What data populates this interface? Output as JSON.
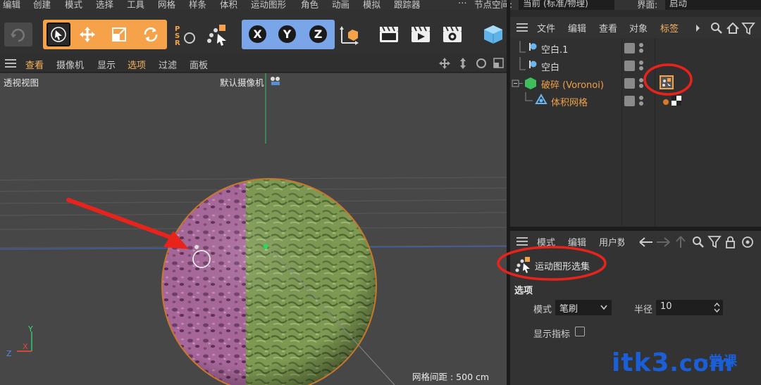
{
  "menubar": {
    "items": [
      "编辑",
      "创建",
      "模式",
      "选择",
      "工具",
      "网格",
      "样条",
      "体积",
      "运动图形",
      "角色",
      "动画",
      "模拟",
      "跟踪器"
    ],
    "node_space_label": "节点空间:",
    "node_space_value": "当前 (标准/物理)",
    "layout_label": "界面:",
    "layout_value": "启动"
  },
  "toolbar": {
    "axis_x": "X",
    "axis_y": "Y",
    "axis_z": "Z"
  },
  "viewport": {
    "menu": [
      "查看",
      "摄像机",
      "显示",
      "选项",
      "过滤",
      "面板"
    ],
    "title": "透视视图",
    "camera": "默认摄像机",
    "grid_spacing": "网格间距 : 500 cm",
    "axis_labels": {
      "y": "Y",
      "x": "X",
      "z": "Z"
    }
  },
  "object_manager": {
    "menu": [
      "文件",
      "编辑",
      "查看",
      "对象",
      "标签"
    ],
    "objects": [
      {
        "name": "空白.1"
      },
      {
        "name": "空白"
      },
      {
        "name": "破碎 (Voronoi)"
      },
      {
        "name": "体积网格"
      }
    ],
    "colors": {
      "selected_text": "#f0a04a",
      "child_text": "#f0a04a"
    }
  },
  "attribute_manager": {
    "menu": [
      "模式",
      "编辑",
      "用户数"
    ],
    "tag_name": "运动图形选集",
    "section": "选项",
    "mode_label": "模式",
    "mode_value": "笔刷",
    "radius_label": "半径",
    "radius_value": "10",
    "show_indicator_label": "显示指标"
  },
  "watermark": {
    "text": "itk3",
    "suffix": ".com",
    "top": "一堂课"
  },
  "colors": {
    "accent": "#f6a24a",
    "annotation": "#e8231c",
    "axis_button": "#7aa5e8",
    "sphere_pink": "#a8679a",
    "sphere_green": "#7e9a52"
  }
}
